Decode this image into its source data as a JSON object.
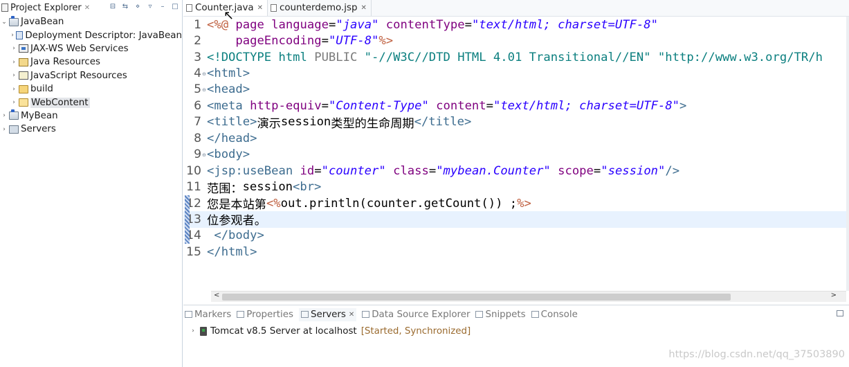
{
  "explorer": {
    "title": "Project Explorer",
    "close": "✕",
    "tree": [
      {
        "label": "JavaBean",
        "icon": "project-icon",
        "depth": 0,
        "expanded": true
      },
      {
        "label": "Deployment Descriptor: JavaBean",
        "icon": "deployment-descriptor-icon",
        "depth": 1
      },
      {
        "label": "JAX-WS Web Services",
        "icon": "web-services-icon",
        "depth": 1
      },
      {
        "label": "Java Resources",
        "icon": "java-resources-icon",
        "depth": 1
      },
      {
        "label": "JavaScript Resources",
        "icon": "javascript-resources-icon",
        "depth": 1
      },
      {
        "label": "build",
        "icon": "folder-icon",
        "depth": 1
      },
      {
        "label": "WebContent",
        "icon": "folder-open-icon",
        "depth": 1,
        "selected": true
      },
      {
        "label": "MyBean",
        "icon": "project-icon",
        "depth": 0
      },
      {
        "label": "Servers",
        "icon": "servers-folder-icon",
        "depth": 0
      }
    ]
  },
  "editor": {
    "tabs": [
      {
        "label": "Counter.java",
        "active": true
      },
      {
        "label": "counterdemo.jsp",
        "active": false
      }
    ],
    "current_line": 13,
    "lines": [
      {
        "n": "1",
        "tokens": [
          [
            "dir",
            "<%@ "
          ],
          [
            "attr",
            "page "
          ],
          [
            "attr",
            "language"
          ],
          [
            "txt",
            "="
          ],
          [
            "val",
            "\"java\""
          ],
          [
            "txt",
            " "
          ],
          [
            "attr",
            "contentType"
          ],
          [
            "txt",
            "="
          ],
          [
            "val",
            "\"text/html; charset=UTF-8\""
          ]
        ]
      },
      {
        "n": "2",
        "tokens": [
          [
            "txt",
            "    "
          ],
          [
            "attr",
            "pageEncoding"
          ],
          [
            "txt",
            "="
          ],
          [
            "val",
            "\"UTF-8\""
          ],
          [
            "dir",
            "%>"
          ]
        ]
      },
      {
        "n": "3",
        "tokens": [
          [
            "doc",
            "<!DOCTYPE "
          ],
          [
            "doc",
            "html "
          ],
          [
            "pub",
            "PUBLIC "
          ],
          [
            "doc",
            "\"-//W3C//DTD HTML 4.01 Transitional//EN\" \"http://www.w3.org/TR/h"
          ]
        ]
      },
      {
        "n": "4",
        "fold": true,
        "tokens": [
          [
            "tag",
            "<html>"
          ]
        ]
      },
      {
        "n": "5",
        "fold": true,
        "tokens": [
          [
            "tag",
            "<head>"
          ]
        ]
      },
      {
        "n": "6",
        "tokens": [
          [
            "tag",
            "<meta "
          ],
          [
            "attr",
            "http-equiv"
          ],
          [
            "txt",
            "="
          ],
          [
            "val",
            "\"Content-Type\""
          ],
          [
            "txt",
            " "
          ],
          [
            "attr",
            "content"
          ],
          [
            "txt",
            "="
          ],
          [
            "val",
            "\"text/html; charset=UTF-8\""
          ],
          [
            "tag",
            ">"
          ]
        ]
      },
      {
        "n": "7",
        "tokens": [
          [
            "tag",
            "<title>"
          ],
          [
            "cjk",
            "演示"
          ],
          [
            "txt",
            "session"
          ],
          [
            "cjk",
            "类型的生命周期"
          ],
          [
            "tag",
            "</title>"
          ]
        ]
      },
      {
        "n": "8",
        "tokens": [
          [
            "tag",
            "</head>"
          ]
        ]
      },
      {
        "n": "9",
        "fold": true,
        "tokens": [
          [
            "tag",
            "<body>"
          ]
        ]
      },
      {
        "n": "10",
        "tokens": [
          [
            "tag",
            "<jsp:useBean "
          ],
          [
            "attr",
            "id"
          ],
          [
            "txt",
            "="
          ],
          [
            "val",
            "\"counter\""
          ],
          [
            "txt",
            " "
          ],
          [
            "attr",
            "class"
          ],
          [
            "txt",
            "="
          ],
          [
            "val",
            "\"mybean.Counter\""
          ],
          [
            "txt",
            " "
          ],
          [
            "attr",
            "scope"
          ],
          [
            "txt",
            "="
          ],
          [
            "val",
            "\"session\""
          ],
          [
            "tag",
            "/>"
          ]
        ]
      },
      {
        "n": "11",
        "tokens": [
          [
            "cjk",
            "范围："
          ],
          [
            "txt",
            "session"
          ],
          [
            "tag",
            "<br>"
          ]
        ]
      },
      {
        "n": "12",
        "tokens": [
          [
            "cjk",
            "您是本站第"
          ],
          [
            "dir",
            "<%"
          ],
          [
            "txt",
            "out.println(counter.getCount()) ;"
          ],
          [
            "dir",
            "%>"
          ]
        ]
      },
      {
        "n": "13",
        "tokens": [
          [
            "cjk",
            "位参观者。"
          ]
        ]
      },
      {
        "n": "14",
        "tokens": [
          [
            "txt",
            " "
          ],
          [
            "tag",
            "</body>"
          ]
        ]
      },
      {
        "n": "15",
        "tokens": [
          [
            "tag",
            "</html>"
          ]
        ]
      }
    ]
  },
  "bottom": {
    "tabs": [
      {
        "label": "Markers",
        "active": false
      },
      {
        "label": "Properties",
        "active": false
      },
      {
        "label": "Servers",
        "active": true
      },
      {
        "label": "Data Source Explorer",
        "active": false
      },
      {
        "label": "Snippets",
        "active": false
      },
      {
        "label": "Console",
        "active": false
      }
    ],
    "server": {
      "name": "Tomcat v8.5 Server at localhost",
      "state": "[Started, Synchronized]"
    }
  },
  "watermark": "https://blog.csdn.net/qq_37503890",
  "colors": {
    "tag": "#3d6c8f",
    "directive": "#bf5f3f",
    "attribute": "#7f007f",
    "value": "#2a00ff",
    "doctype": "#0b7f7f",
    "current_line": "#e8f2fe",
    "selection": "#e4e6ea"
  }
}
